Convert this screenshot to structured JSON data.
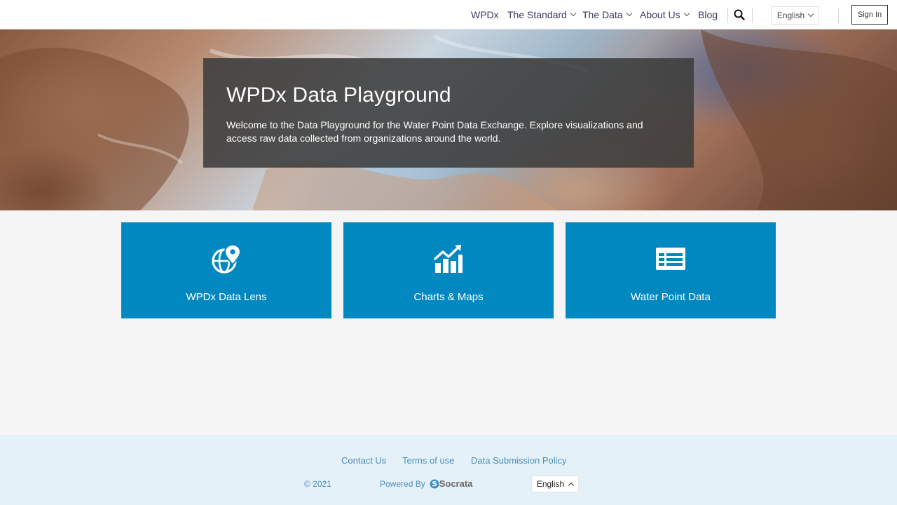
{
  "nav": {
    "items": [
      {
        "label": "WPDx"
      },
      {
        "label": "The Standard"
      },
      {
        "label": "The Data"
      },
      {
        "label": "About Us"
      },
      {
        "label": "Blog"
      }
    ],
    "language": "English",
    "signin_label": "Sign In"
  },
  "hero": {
    "title": "WPDx Data Playground",
    "description": "Welcome to the Data Playground for the Water Point Data Exchange. Explore visualizations and access raw data collected from organizations around the world."
  },
  "tiles": [
    {
      "label": "WPDx Data Lens",
      "icon": "globe-pin-icon"
    },
    {
      "label": "Charts & Maps",
      "icon": "chart-trend-icon"
    },
    {
      "label": "Water Point Data",
      "icon": "table-icon"
    }
  ],
  "footer": {
    "links": [
      {
        "label": "Contact Us"
      },
      {
        "label": "Terms of use"
      },
      {
        "label": "Data Submission Policy"
      }
    ],
    "copyright": "© 2021",
    "powered_by": "Powered By",
    "brand": "Socrata",
    "language": "English"
  },
  "colors": {
    "tile": "#0288c1",
    "footer_bg": "#e5f1f8",
    "footer_link": "#4a90b8"
  }
}
